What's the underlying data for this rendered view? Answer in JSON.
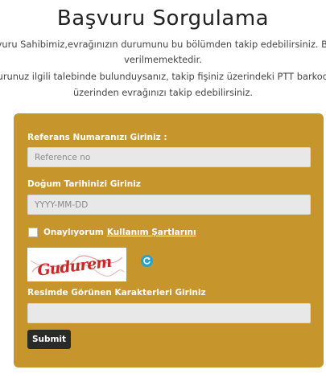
{
  "page": {
    "title": "Başvuru Sorgulama",
    "description_lines": [
      "Sayın Başvuru Sahibimiz,evrağınızın durumunu bu bölümden takip edebilirsiniz. Başvuru tamamlanmadan pasaport",
      "verilmemektedir.",
      "Eğer başvurunuz ilgili talebinde bulunduysanız, takip fişiniz üzerindeki PTT barkod numarası ile",
      "üzerinden evrağınızı takip edebilirsiniz."
    ]
  },
  "form": {
    "reference_label": "Referans Numaranızı Giriniz :",
    "reference_placeholder": "Reference no",
    "reference_value": "",
    "dob_label": "Doğum Tarihinizi Giriniz",
    "dob_placeholder": "YYYY-MM-DD",
    "dob_value": "",
    "agree_text": "Onaylıyorum",
    "terms_link": "Kullanım Şartlarını",
    "agree_checked": false,
    "captcha_text": "Gudurem",
    "captcha_label": "Resimde Görünen Karakterleri Giriniz",
    "captcha_value": "",
    "submit_label": "Submit"
  },
  "colors": {
    "panel": "#c6952b",
    "submit": "#2a2a2a",
    "refresh": "#2ba3c9",
    "captcha_text": "#c62828"
  },
  "icons": {
    "refresh": "refresh-icon",
    "checkbox": "checkbox-icon"
  }
}
